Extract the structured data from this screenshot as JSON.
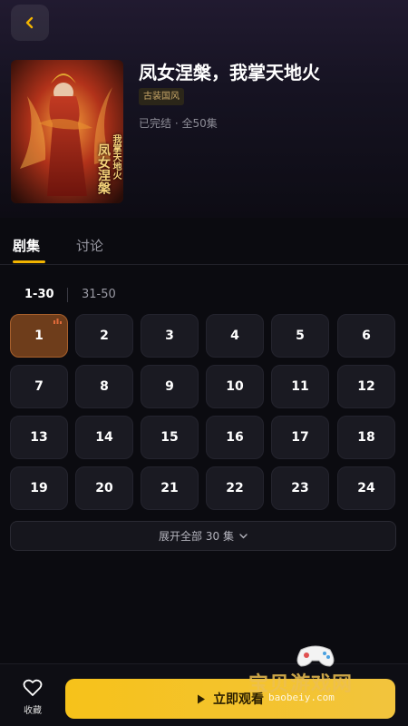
{
  "header": {
    "back_icon": "chevron-left-icon",
    "accent_color": "#f2b400"
  },
  "drama": {
    "title": "凤女涅槃，我掌天地火",
    "tag": "古装国风",
    "status": "已完结 · 全50集",
    "cover_text_main": "凤女涅槃",
    "cover_text_sub": "我掌天地火"
  },
  "tabs": [
    {
      "label": "剧集",
      "active": true
    },
    {
      "label": "讨论",
      "active": false
    }
  ],
  "ranges": [
    {
      "label": "1-30",
      "active": true
    },
    {
      "label": "31-50",
      "active": false
    }
  ],
  "episodes": [
    "1",
    "2",
    "3",
    "4",
    "5",
    "6",
    "7",
    "8",
    "9",
    "10",
    "11",
    "12",
    "13",
    "14",
    "15",
    "16",
    "17",
    "18",
    "19",
    "20",
    "21",
    "22",
    "23",
    "24"
  ],
  "current_episode": "1",
  "expand": {
    "label": "展开全部 30 集",
    "icon": "chevron-down-icon"
  },
  "bottom": {
    "fav_label": "收藏",
    "play_label": "立即观看",
    "play_color": "#f6c21a"
  },
  "watermark": {
    "text": "宝贝游戏网",
    "url": "baobeiy.com"
  }
}
